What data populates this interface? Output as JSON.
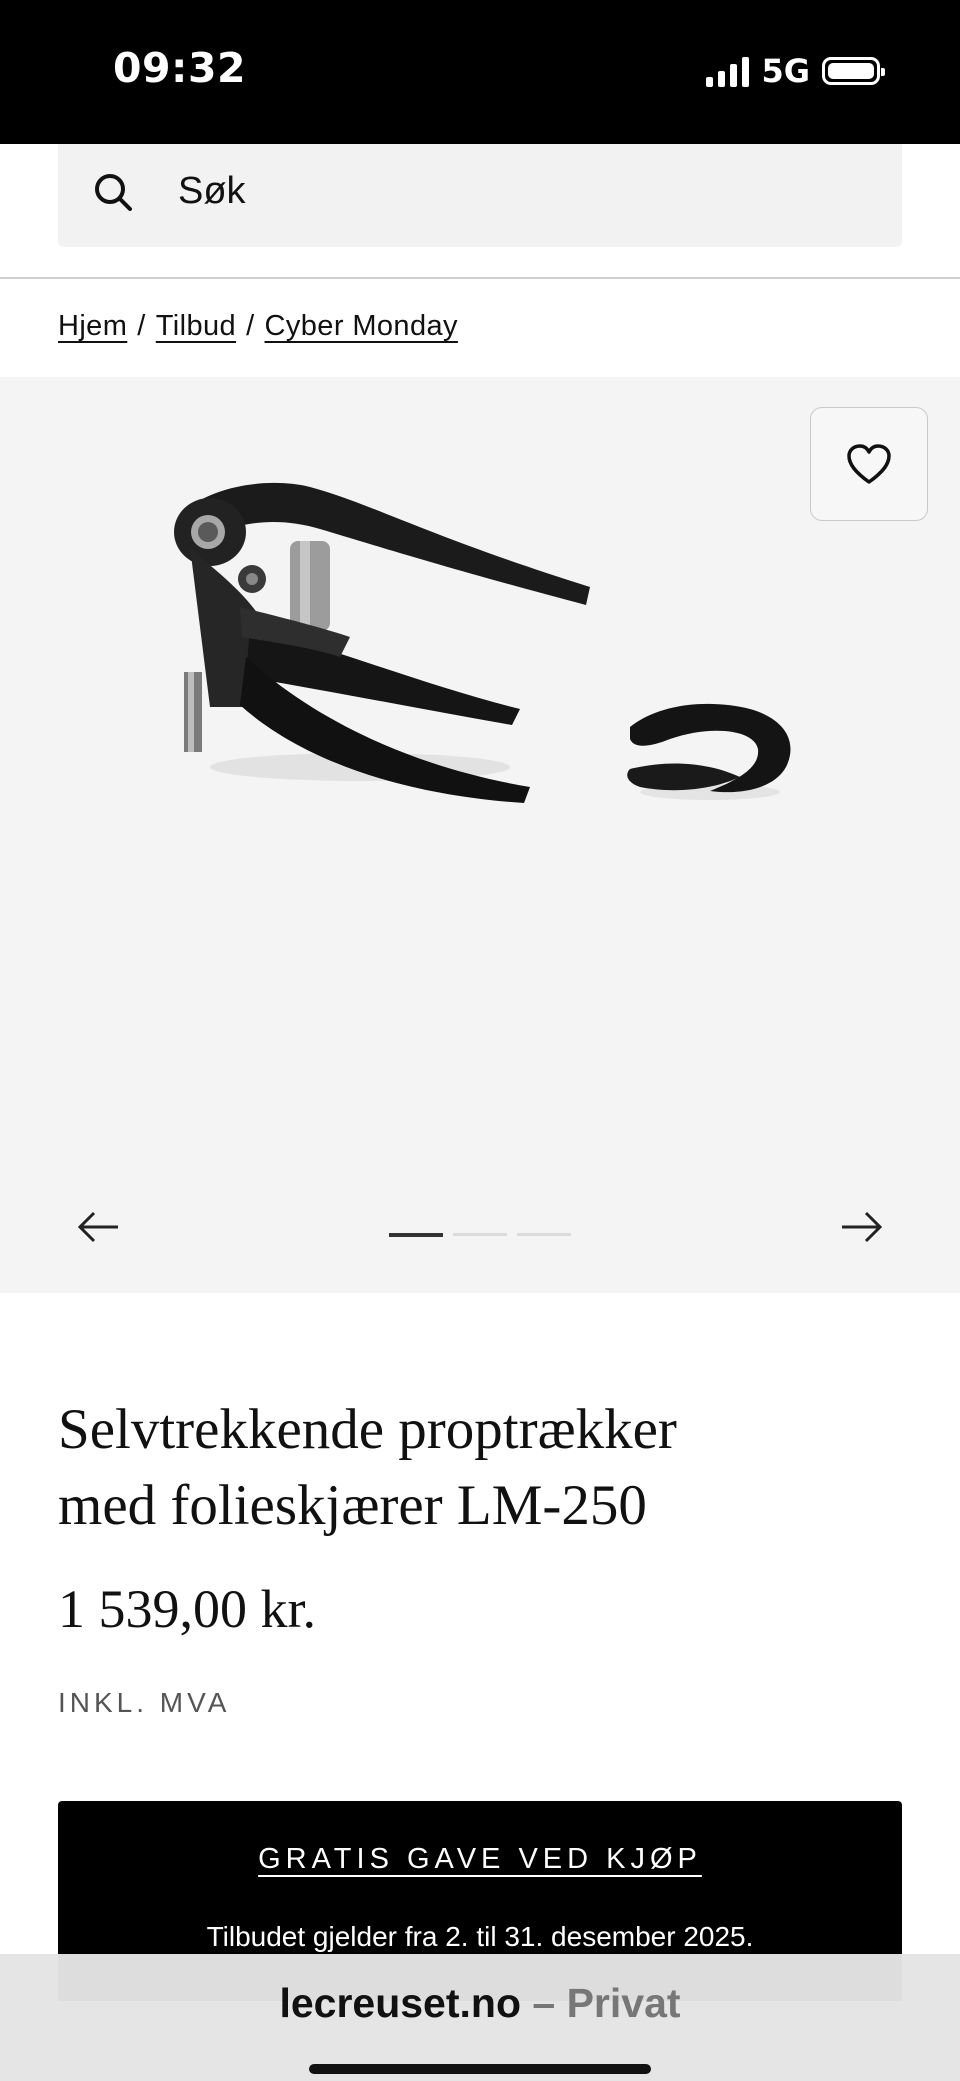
{
  "status_bar": {
    "time": "09:32",
    "network": "5G",
    "icons": [
      "signal-icon",
      "battery-icon"
    ]
  },
  "search": {
    "placeholder": "Søk",
    "icon": "search-icon"
  },
  "breadcrumb": {
    "items": [
      "Hjem",
      "Tilbud",
      "Cyber Monday"
    ],
    "separator": "/"
  },
  "gallery": {
    "favorite_icon": "heart-icon",
    "prev_icon": "arrow-left-icon",
    "next_icon": "arrow-right-icon",
    "slide_count": 3,
    "active_slide": 1
  },
  "product": {
    "title_line1": "Selvtrekkende proptrækker",
    "title_line2": "med folieskjærer LM-250",
    "price": "1 539,00 kr.",
    "vat_note": "INKL. MVA"
  },
  "promo": {
    "heading": "GRATIS GAVE VED KJØP",
    "text": "Tilbudet gjelder fra 2. til 31. desember 2025."
  },
  "browser": {
    "domain": "lecreuset.no",
    "mode": " – Privat"
  }
}
